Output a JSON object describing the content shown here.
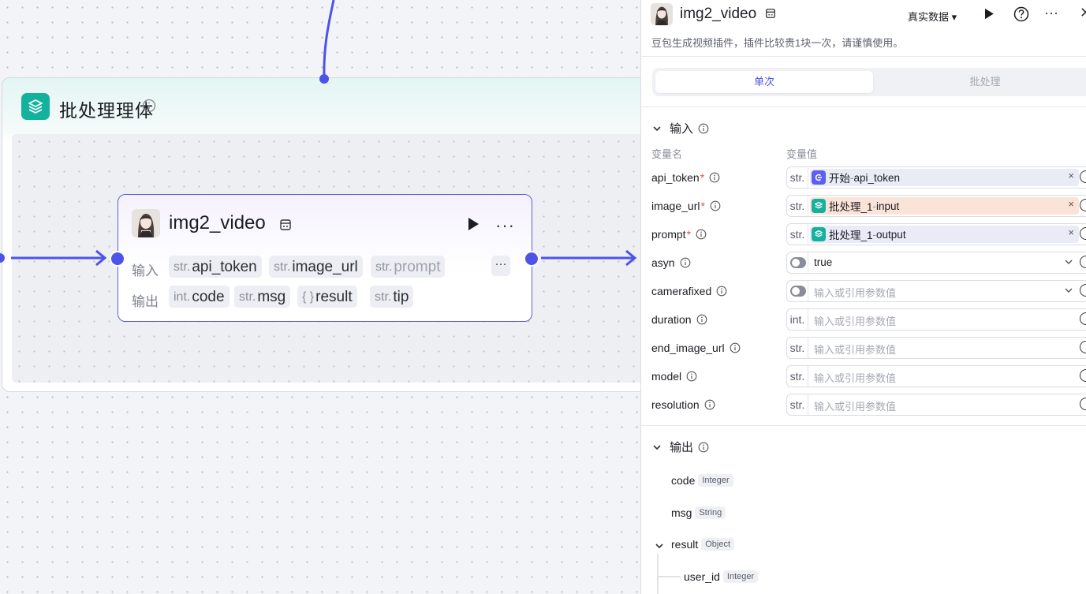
{
  "canvas": {
    "batch": {
      "title": "批处理理体",
      "icon": "layers-icon"
    },
    "node": {
      "title": "img2_video",
      "input_label": "输入",
      "output_label": "输出",
      "inputs": [
        {
          "type": "str.",
          "name": "api_token"
        },
        {
          "type": "str.",
          "name": "image_url"
        },
        {
          "type": "str.",
          "name": "prompt"
        }
      ],
      "outputs": [
        {
          "type": "int.",
          "name": "code"
        },
        {
          "type": "str.",
          "name": "msg"
        },
        {
          "type": "{ }",
          "name": "result"
        },
        {
          "type": "str.",
          "name": "tip"
        }
      ],
      "more_chip": "···",
      "more": "···"
    }
  },
  "panel": {
    "title": "img2_video",
    "description": "豆包生成视频插件，插件比较贵1块一次，请谨慎使用。",
    "mode_selector": "真实数据 ▾",
    "more": "···",
    "close": "✕",
    "tabs": {
      "single": "单次",
      "batch": "批处理"
    },
    "input_section": "输入",
    "col_name": "变量名",
    "col_value": "变量值",
    "inputs": [
      {
        "name": "api_token",
        "required": "*",
        "type": "str.",
        "ref_source": "开始",
        "ref_sep": " - ",
        "ref_var": "api_token",
        "remove": "×"
      },
      {
        "name": "image_url",
        "required": "*",
        "type": "str.",
        "ref_source": "批处理_1",
        "ref_sep": " - ",
        "ref_var": "input",
        "remove": "×"
      },
      {
        "name": "prompt",
        "required": "*",
        "type": "str.",
        "ref_source": "批处理_1",
        "ref_sep": " - ",
        "ref_var": "output",
        "remove": "×"
      },
      {
        "name": "asyn",
        "value": "true"
      },
      {
        "name": "camerafixed",
        "placeholder": "输入或引用参数值"
      },
      {
        "name": "duration",
        "type": "int.",
        "placeholder": "输入或引用参数值"
      },
      {
        "name": "end_image_url",
        "type": "str.",
        "placeholder": "输入或引用参数值"
      },
      {
        "name": "model",
        "type": "str.",
        "placeholder": "输入或引用参数值"
      },
      {
        "name": "resolution",
        "type": "str.",
        "placeholder": "输入或引用参数值"
      }
    ],
    "output_section": "输出",
    "outputs": [
      {
        "name": "code",
        "type": "Integer"
      },
      {
        "name": "msg",
        "type": "String"
      },
      {
        "name": "result",
        "type": "Object"
      },
      {
        "name": "user_id",
        "type": "Integer"
      }
    ]
  },
  "colors": {
    "accent": "#4d53e8",
    "batch_icon": "#14b19d",
    "start_icon": "#5b5ff2",
    "warm_ref": "#fbe3d8"
  }
}
